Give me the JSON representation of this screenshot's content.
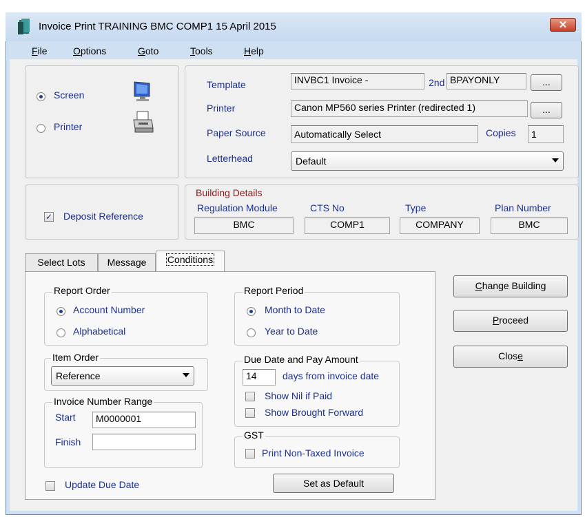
{
  "window": {
    "title": "Invoice Print TRAINING BMC COMP1 15 April 2015",
    "close_glyph": "✕"
  },
  "menu": [
    {
      "pre": "",
      "key": "F",
      "post": "ile"
    },
    {
      "pre": "",
      "key": "O",
      "post": "ptions"
    },
    {
      "pre": "",
      "key": "G",
      "post": "oto"
    },
    {
      "pre": "",
      "key": "T",
      "post": "ools"
    },
    {
      "pre": "",
      "key": "H",
      "post": "elp"
    }
  ],
  "output": {
    "screen_label": "Screen",
    "printer_label": "Printer",
    "selected": "Screen"
  },
  "print_settings": {
    "template_label": "Template",
    "template_value": "INVBC1 Invoice -",
    "second_label": "2nd",
    "second_value": "BPAYONLY",
    "browse_label": "...",
    "printer_label": "Printer",
    "printer_value": "Canon MP560 series Printer (redirected 1)",
    "paper_source_label": "Paper Source",
    "paper_source_value": "Automatically Select",
    "copies_label": "Copies",
    "copies_value": "1",
    "letterhead_label": "Letterhead",
    "letterhead_value": "Default"
  },
  "deposit_reference": {
    "label": "Deposit Reference",
    "checked": true
  },
  "building_details": {
    "title": "Building Details",
    "columns": [
      {
        "label": "Regulation Module",
        "value": "BMC"
      },
      {
        "label": "CTS No",
        "value": "COMP1"
      },
      {
        "label": "Type",
        "value": "COMPANY"
      },
      {
        "label": "Plan Number",
        "value": "BMC"
      }
    ]
  },
  "tabs": [
    {
      "label": "Select Lots",
      "active": false
    },
    {
      "label": "Message",
      "active": false
    },
    {
      "label": "Conditions",
      "active": true
    }
  ],
  "conditions": {
    "report_order": {
      "title": "Report Order",
      "options": [
        "Account Number",
        "Alphabetical"
      ],
      "selected": "Account Number"
    },
    "report_period": {
      "title": "Report Period",
      "options": [
        "Month to Date",
        "Year to Date"
      ],
      "selected": "Month to Date"
    },
    "item_order": {
      "title": "Item Order",
      "value": "Reference"
    },
    "due_date": {
      "title": "Due Date and Pay Amount",
      "days_value": "14",
      "days_label": "days from invoice date",
      "show_nil_label": "Show Nil if Paid",
      "show_brought_forward_label": "Show Brought Forward"
    },
    "invoice_range": {
      "title": "Invoice Number Range",
      "start_label": "Start",
      "start_value": "M0000001",
      "finish_label": "Finish",
      "finish_value": ""
    },
    "gst": {
      "title": "GST",
      "print_non_taxed_label": "Print Non-Taxed Invoice"
    },
    "update_due_date_label": "Update Due Date",
    "set_default_label": "Set as Default"
  },
  "actions": {
    "change_building": {
      "pre": "",
      "key": "C",
      "post": "hange Building"
    },
    "proceed": {
      "pre": "",
      "key": "P",
      "post": "roceed"
    },
    "close": {
      "pre": "Clos",
      "key": "e",
      "post": ""
    }
  },
  "colors": {
    "label_blue": "#1b2f90",
    "group_red": "#8b1a1a",
    "close_red": "#c6422a"
  }
}
